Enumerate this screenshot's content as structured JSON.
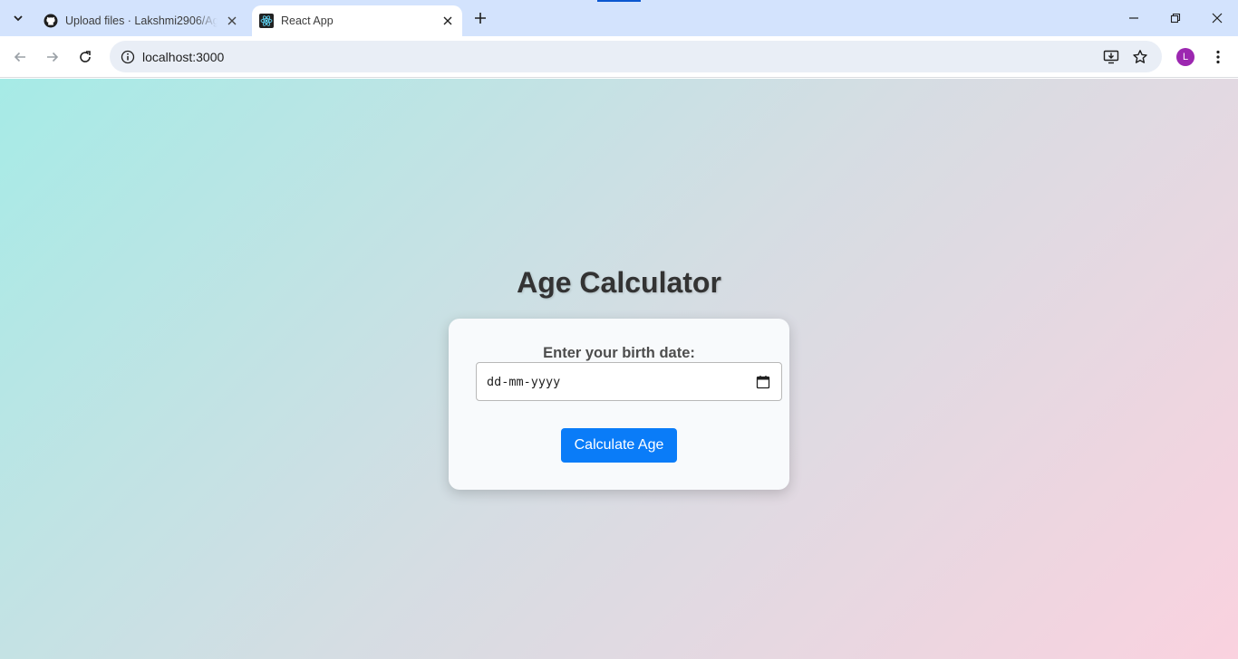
{
  "browser": {
    "tabs": [
      {
        "title": "Upload files · Lakshmi2906/Age",
        "active": false,
        "icon": "github-icon"
      },
      {
        "title": "React App",
        "active": true,
        "icon": "react-icon"
      }
    ],
    "url": "localhost:3000",
    "profile_initial": "L",
    "profile_color": "#9c27b0"
  },
  "page": {
    "title": "Age Calculator",
    "form": {
      "label": "Enter your birth date:",
      "date_placeholder": "dd-mm-yyyy",
      "submit_label": "Calculate Age"
    }
  },
  "colors": {
    "accent": "#0a7cf8",
    "background_start": "#a6ebe6",
    "background_end": "#fad2df",
    "card": "#f8fafc"
  }
}
